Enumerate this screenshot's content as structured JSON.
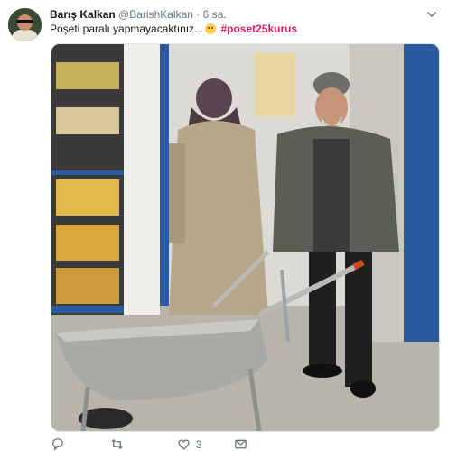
{
  "tweet": {
    "author_name": "Barış Kalkan",
    "handle": "@BarishKalkan",
    "separator": "·",
    "time": "6 sa.",
    "text": "Poşeti paralı yapmayacaktınız...",
    "hashtag": "#poset25kurus",
    "like_count": "3"
  },
  "icons": {
    "more": "chevron-down-icon",
    "reply": "reply-icon",
    "retweet": "retweet-icon",
    "like": "heart-icon",
    "message": "envelope-icon",
    "emoji": "grinning-face-emoji"
  },
  "colors": {
    "name": "#14171a",
    "secondary": "#657786",
    "hashtag": "#e0245e",
    "border": "#e1e8ed"
  }
}
